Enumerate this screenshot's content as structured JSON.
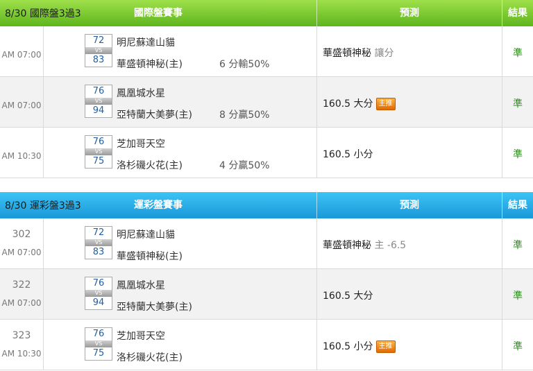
{
  "sections": [
    {
      "title": "8/30 國際盤3過3",
      "theme": "green",
      "col_event": "國際盤賽事",
      "col_predict": "預測",
      "col_result": "結果",
      "rows": [
        {
          "num": "",
          "time": "AM 07:00",
          "away_score": "72",
          "home_score": "83",
          "away": "明尼蘇達山貓",
          "home": "華盛頓神秘(主)",
          "handicap": "6 分輸50%",
          "predict": "華盛頓神秘",
          "predict_sub": "讓分",
          "badge": "",
          "result": "準"
        },
        {
          "num": "",
          "time": "AM 07:00",
          "away_score": "76",
          "home_score": "94",
          "away": "鳳凰城水星",
          "home": "亞特蘭大美夢(主)",
          "handicap": "8 分贏50%",
          "predict": "160.5 大分",
          "predict_sub": "",
          "badge": "主推",
          "result": "準"
        },
        {
          "num": "",
          "time": "AM 10:30",
          "away_score": "76",
          "home_score": "75",
          "away": "芝加哥天空",
          "home": "洛杉磯火花(主)",
          "handicap": "4 分贏50%",
          "predict": "160.5 小分",
          "predict_sub": "",
          "badge": "",
          "result": "準"
        }
      ]
    },
    {
      "title": "8/30 運彩盤3過3",
      "theme": "blue",
      "col_event": "運彩盤賽事",
      "col_predict": "預測",
      "col_result": "結果",
      "rows": [
        {
          "num": "302",
          "time": "AM 07:00",
          "away_score": "72",
          "home_score": "83",
          "away": "明尼蘇達山貓",
          "home": "華盛頓神秘(主)",
          "handicap": "",
          "predict": "華盛頓神秘",
          "predict_sub": "主 -6.5",
          "badge": "",
          "result": "準"
        },
        {
          "num": "322",
          "time": "AM 07:00",
          "away_score": "76",
          "home_score": "94",
          "away": "鳳凰城水星",
          "home": "亞特蘭大美夢(主)",
          "handicap": "",
          "predict": "160.5 大分",
          "predict_sub": "",
          "badge": "",
          "result": "準"
        },
        {
          "num": "323",
          "time": "AM 10:30",
          "away_score": "76",
          "home_score": "75",
          "away": "芝加哥天空",
          "home": "洛杉磯火花(主)",
          "handicap": "",
          "predict": "160.5 小分",
          "predict_sub": "",
          "badge": "主推",
          "result": "準"
        }
      ]
    }
  ]
}
